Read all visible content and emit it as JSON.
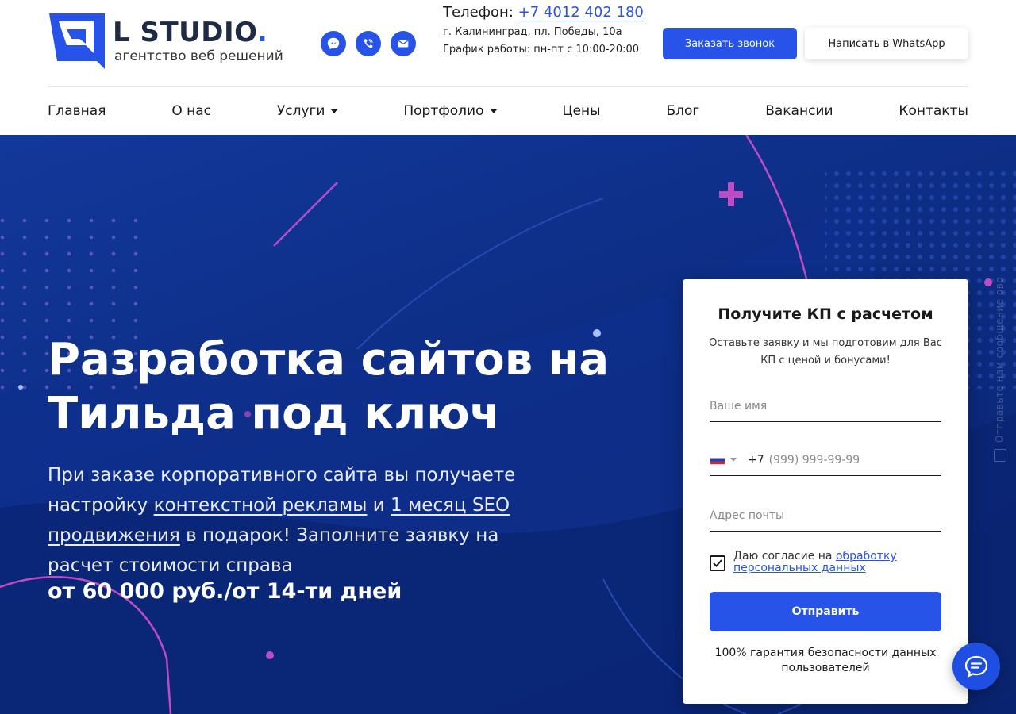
{
  "brand": {
    "name": "L STUDIO",
    "dot": ".",
    "tagline": "агентство веб решений",
    "accent_color": "#2753e8"
  },
  "header": {
    "social_icons": [
      "messenger-icon",
      "viber-icon",
      "email-icon"
    ],
    "phone_label": "Телефон:",
    "phone_number": "+7 4012 402 180",
    "address": "г. Калининград, пл. Победы, 10а",
    "schedule": "График работы: пн-пт с 10:00-20:00",
    "call_button": "Заказать звонок",
    "whatsapp_button": "Написать в WhatsApp"
  },
  "nav": {
    "items": [
      {
        "label": "Главная",
        "dropdown": false
      },
      {
        "label": "О нас",
        "dropdown": false
      },
      {
        "label": "Услуги",
        "dropdown": true
      },
      {
        "label": "Портфолио",
        "dropdown": true
      },
      {
        "label": "Цены",
        "dropdown": false
      },
      {
        "label": "Блог",
        "dropdown": false
      },
      {
        "label": "Вакансии",
        "dropdown": false
      },
      {
        "label": "Контакты",
        "dropdown": false
      }
    ]
  },
  "hero": {
    "title_line1": "Разработка сайтов на",
    "title_line2": "Тильда под ключ",
    "text_part1": "При заказе корпоративного сайта вы получаете настройку ",
    "link_ads": "контекстной рекламы",
    "text_part2": " и ",
    "link_seo": "1 месяц SEO продвижения",
    "text_part3": " в подарок! Заполните заявку на расчет стоимости справа",
    "price": "от 60 000 руб./от 14-ти дней"
  },
  "form": {
    "title": "Получите КП с расчетом",
    "subtitle": "Оставьте заявку и мы подготовим для Вас КП с ценой и бонусами!",
    "name_placeholder": "Ваше имя",
    "phone_code": "+7",
    "phone_placeholder": "(999) 999-99-99",
    "email_placeholder": "Адрес почты",
    "consent_text": "Даю согласие на ",
    "consent_link": "обработку персональных данных",
    "consent_checked": true,
    "submit": "Отправить",
    "guarantee": "100% гарантия безопасности данных пользователей"
  },
  "side_tab": {
    "label": "Отправьте нам сообщение ово"
  },
  "chat": {
    "icon": "chat-bubble-icon"
  }
}
